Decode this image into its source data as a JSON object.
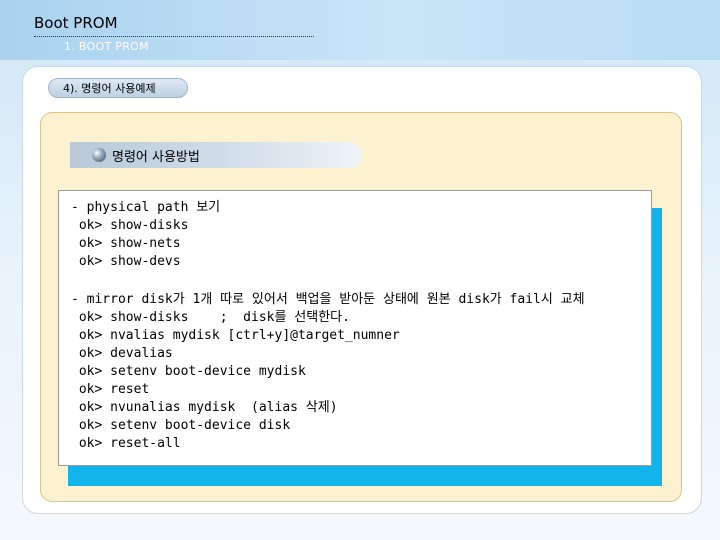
{
  "header": {
    "title": "Boot PROM",
    "subtitle": "1. BOOT PROM"
  },
  "section": {
    "label": "4). 명령어 사용예제"
  },
  "card": {
    "heading": "명령어 사용방법"
  },
  "code_lines": [
    "- physical path 보기",
    " ok> show-disks",
    " ok> show-nets",
    " ok> show-devs",
    "- mirror disk가 1개 따로 있어서 백업을 받아둔 상태에 원본 disk가 fail시 교체",
    " ok> show-disks    ;  disk를 선택한다.",
    " ok> nvalias mydisk [ctrl+y]@target_numner",
    " ok> devalias",
    " ok> setenv boot-device mydisk",
    " ok> reset",
    " ok> nvunalias mydisk  (alias 삭제)",
    " ok> setenv boot-device disk",
    " ok> reset-all"
  ],
  "colors": {
    "accent_cyan": "#12b4ec",
    "panel_beige": "#fdf2cf"
  }
}
